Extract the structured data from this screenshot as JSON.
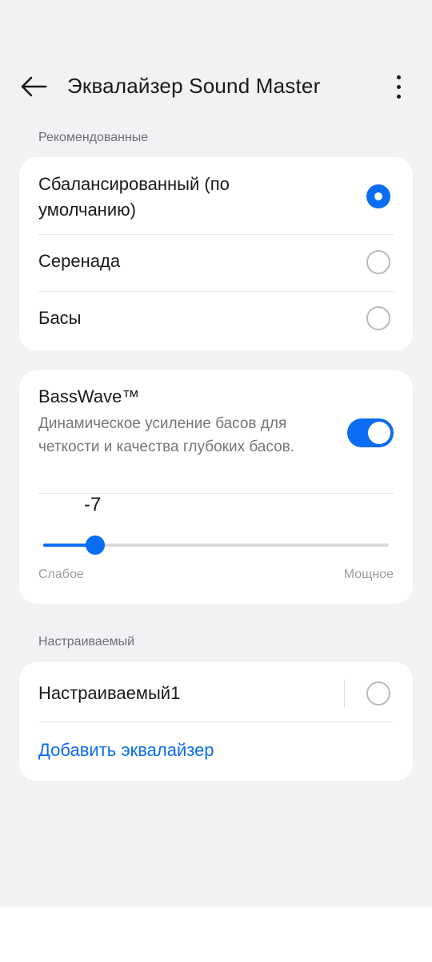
{
  "header": {
    "title": "Эквалайзер Sound Master",
    "back_icon": "arrow-left-icon",
    "more_icon": "more-vertical-icon"
  },
  "recommended": {
    "section_label": "Рекомендованные",
    "items": [
      {
        "label": "Сбалансированный (по умолчанию)",
        "selected": true
      },
      {
        "label": "Серенада",
        "selected": false
      },
      {
        "label": "Басы",
        "selected": false
      }
    ]
  },
  "basswave": {
    "title": "BassWave™",
    "description": "Динамическое усиление басов для четкости и качества глубоких басов.",
    "enabled": true,
    "slider": {
      "value": -7,
      "value_label": "-7",
      "min": -10,
      "max": 10,
      "fraction": 0.15,
      "min_label": "Слабое",
      "max_label": "Мощное"
    }
  },
  "custom": {
    "section_label": "Настраиваемый",
    "items": [
      {
        "label": "Настраиваемый1",
        "selected": false
      }
    ],
    "add_label": "Добавить эквалайзер"
  },
  "colors": {
    "accent": "#0a6cf2",
    "background": "#f1f2f4",
    "card": "#ffffff"
  }
}
